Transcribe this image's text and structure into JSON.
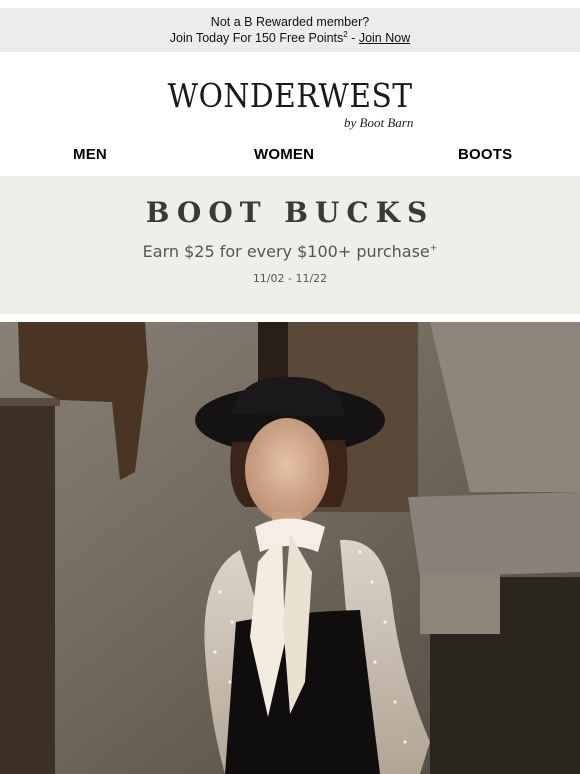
{
  "promo": {
    "line1": "Not a B Rewarded member?",
    "line2_text": "Join Today For 150 Free Points",
    "line2_sup": "2",
    "line2_sep": " - ",
    "join_link": "Join Now"
  },
  "logo": {
    "wordmark": "WONDERWEST",
    "byline": "by Boot Barn"
  },
  "nav": {
    "items": [
      {
        "label": "MEN"
      },
      {
        "label": "WOMEN"
      },
      {
        "label": "BOOTS"
      }
    ]
  },
  "banner": {
    "headline": "BOOT BUCKS",
    "subline": "Earn $25 for every $100+ purchase",
    "subline_sup": "+",
    "dates": "11/02 - 11/22"
  },
  "colors": {
    "promo_bg": "#ececec",
    "banner_bg": "#efefea",
    "banner_text": "#3a3a3a"
  }
}
